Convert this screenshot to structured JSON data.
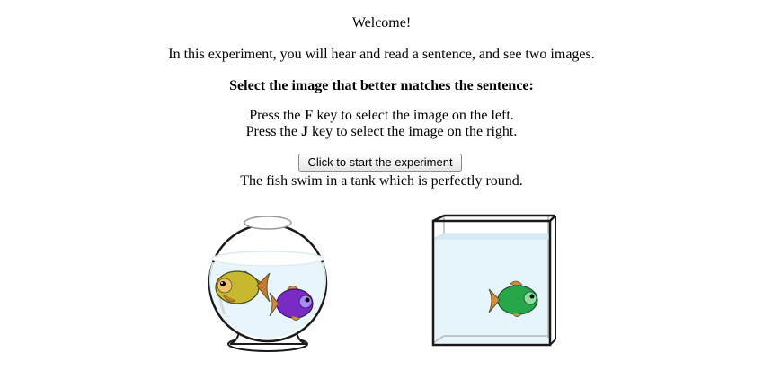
{
  "welcome": "Welcome!",
  "intro": "In this experiment, you will hear and read a sentence, and see two images.",
  "task": "Select the image that better matches the sentence:",
  "instructions": {
    "left": {
      "prefix": "Press the ",
      "key": "F",
      "suffix": " key to select the image on the left."
    },
    "right": {
      "prefix": "Press the ",
      "key": "J",
      "suffix": " key to select the image on the right."
    }
  },
  "start_button": "Click to start the experiment",
  "sentence": "The fish swim in a tank which is perfectly round.",
  "images": {
    "left": {
      "icon": "round-fishbowl-with-two-fish-icon"
    },
    "right": {
      "icon": "square-tank-with-one-fish-icon"
    }
  },
  "colors": {
    "water": "#e6f4fb",
    "fish_yellow": "#c8b82e",
    "fish_purple": "#7a2bc6",
    "fish_green": "#27a64a"
  }
}
